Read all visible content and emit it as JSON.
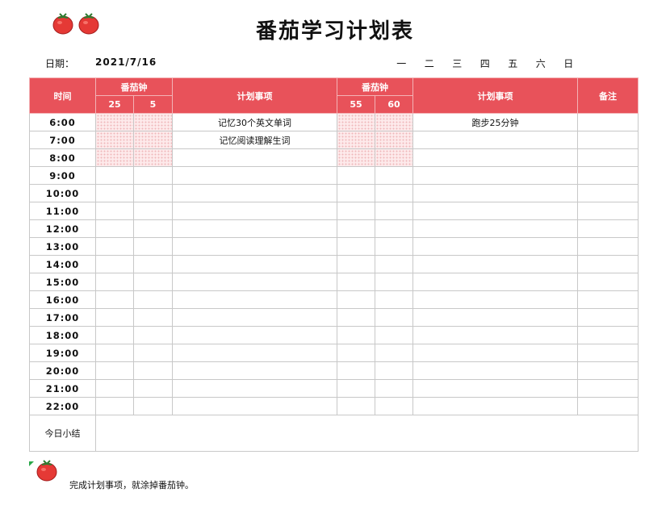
{
  "header": {
    "title": "番茄学习计划表",
    "date_label": "日期：",
    "date_value": "2021/7/16",
    "weekdays": [
      "一",
      "二",
      "三",
      "四",
      "五",
      "六",
      "日"
    ]
  },
  "table": {
    "col_time": "时间",
    "col_pomodoro": "番茄钟",
    "col_plan": "计划事项",
    "col_note": "备注",
    "pomodoro_left_sub": [
      "25",
      "5"
    ],
    "pomodoro_right_sub": [
      "55",
      "60"
    ],
    "rows": [
      {
        "time": "6:00",
        "plan1": "记忆30个英文单词",
        "plan2": "跑步25分钟",
        "note": ""
      },
      {
        "time": "7:00",
        "plan1": "记忆阅读理解生词",
        "plan2": "",
        "note": ""
      },
      {
        "time": "8:00",
        "plan1": "",
        "plan2": "",
        "note": ""
      },
      {
        "time": "9:00",
        "plan1": "",
        "plan2": "",
        "note": ""
      },
      {
        "time": "10:00",
        "plan1": "",
        "plan2": "",
        "note": ""
      },
      {
        "time": "11:00",
        "plan1": "",
        "plan2": "",
        "note": ""
      },
      {
        "time": "12:00",
        "plan1": "",
        "plan2": "",
        "note": ""
      },
      {
        "time": "13:00",
        "plan1": "",
        "plan2": "",
        "note": ""
      },
      {
        "time": "14:00",
        "plan1": "",
        "plan2": "",
        "note": ""
      },
      {
        "time": "15:00",
        "plan1": "",
        "plan2": "",
        "note": ""
      },
      {
        "time": "16:00",
        "plan1": "",
        "plan2": "",
        "note": ""
      },
      {
        "time": "17:00",
        "plan1": "",
        "plan2": "",
        "note": ""
      },
      {
        "time": "18:00",
        "plan1": "",
        "plan2": "",
        "note": ""
      },
      {
        "time": "19:00",
        "plan1": "",
        "plan2": "",
        "note": ""
      },
      {
        "time": "20:00",
        "plan1": "",
        "plan2": "",
        "note": ""
      },
      {
        "time": "21:00",
        "plan1": "",
        "plan2": "",
        "note": ""
      },
      {
        "time": "22:00",
        "plan1": "",
        "plan2": "",
        "note": ""
      }
    ],
    "summary_label": "今日小结"
  },
  "footer": {
    "legend_text": "完成计划事项，就涂掉番茄钟。",
    "icon": "tomato-icon"
  },
  "colors": {
    "header_red": "#e8525a",
    "filled_pink": "#fde9ea"
  }
}
